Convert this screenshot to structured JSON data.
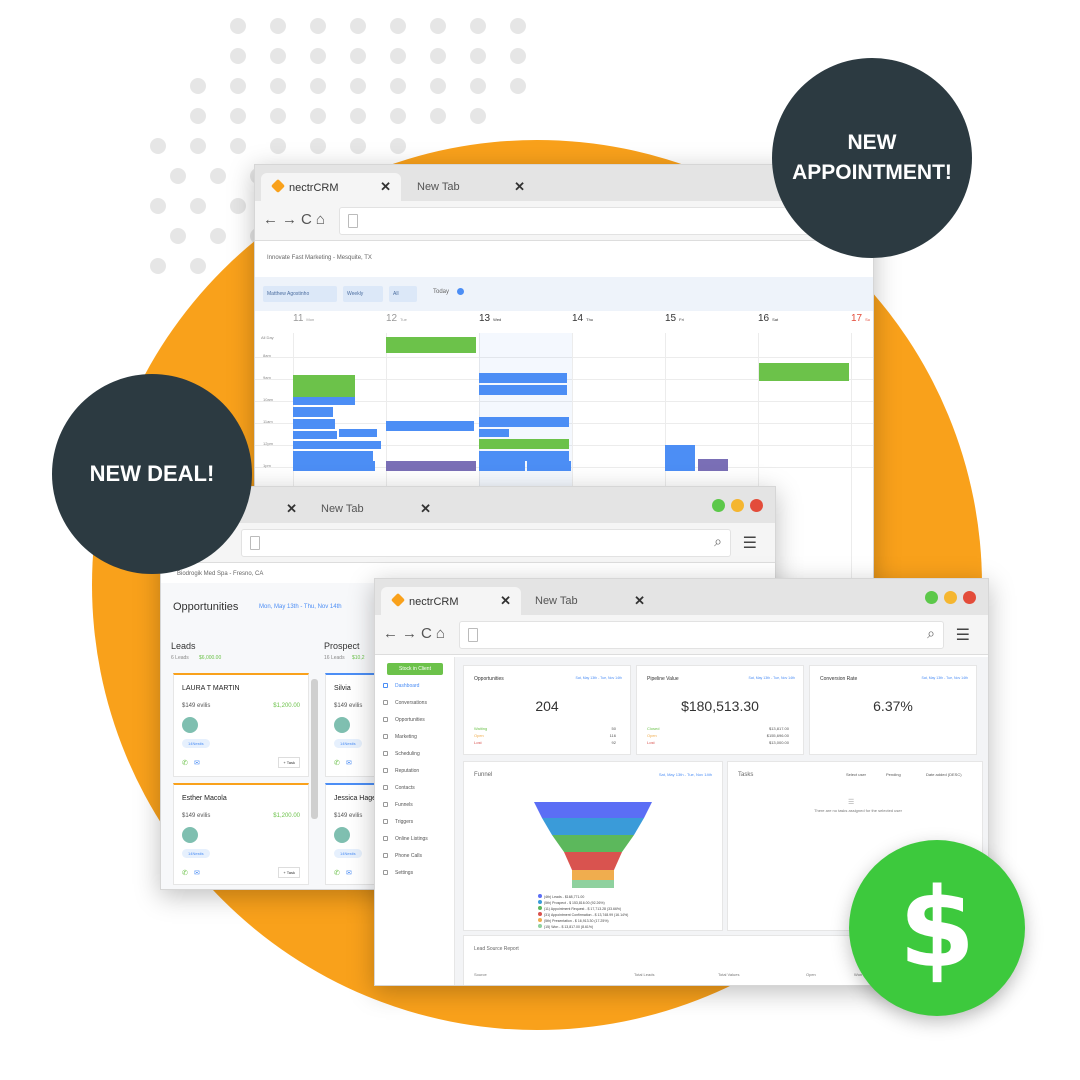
{
  "badges": {
    "appointment_line1": "NEW",
    "appointment_line2": "APPOINTMENT!",
    "deal": "NEW DEAL!"
  },
  "dollar_symbol": "$",
  "calendar_window": {
    "tab_active": "nectrCRM",
    "tab_new": "New Tab",
    "location": "Innovate Fast Marketing - Mesquite, TX",
    "filters": [
      "Matthew Agostinho",
      "Weekly",
      "All"
    ],
    "today": "Today",
    "days": [
      {
        "num": "11",
        "name": "Mon"
      },
      {
        "num": "12",
        "name": "Tue"
      },
      {
        "num": "13",
        "name": "Wed"
      },
      {
        "num": "14",
        "name": "Thu"
      },
      {
        "num": "15",
        "name": "Fri"
      },
      {
        "num": "16",
        "name": "Sat"
      },
      {
        "num": "17",
        "name": "Su"
      }
    ],
    "allday": "All Day",
    "hours": [
      "8am",
      "9am",
      "10am",
      "11am",
      "12pm",
      "1pm"
    ]
  },
  "opportunities_window": {
    "tab_new": "New Tab",
    "location": "Biodrogik Med Spa - Fresno, CA",
    "title": "Opportunities",
    "range": "Mon, May 13th - Thu, Nov 14th",
    "columns": [
      {
        "name": "Leads",
        "sub": "6 Leads",
        "amount": "$6,000.00"
      },
      {
        "name": "Prospect",
        "sub": "16 Leads",
        "amount": "$10,2"
      }
    ],
    "cards": [
      {
        "name": "LAURA T MARTIN",
        "price": "$149 evilis",
        "amount": "$1,200.00",
        "tag": "14Nestis",
        "task": "+ Task"
      },
      {
        "name": "Silvia",
        "price": "$149 evilis",
        "tag": "14Nestis"
      },
      {
        "name": "Esther Macola",
        "price": "$149 evilis",
        "amount": "$1,200.00",
        "tag": "14Nestis",
        "task": "+ Task"
      },
      {
        "name": "Jessica Hage",
        "price": "$149 evilis",
        "tag": "14Nestis"
      }
    ]
  },
  "dashboard_window": {
    "tab_active": "nectrCRM",
    "tab_new": "New Tab",
    "button": "Stock in Client",
    "menu": [
      "Dashboard",
      "Conversations",
      "Opportunities",
      "Marketing",
      "Scheduling",
      "Reputation",
      "Contacts",
      "Funnels",
      "Triggers",
      "Online Listings",
      "Phone Calls",
      "Settings"
    ],
    "stats": [
      {
        "title": "Opportunities",
        "range": "Sat, May 13th - Tue, Nov 14th",
        "value": "204",
        "rows": [
          [
            "Waiting",
            "50"
          ],
          [
            "Open",
            "116"
          ],
          [
            "Lost",
            "92"
          ]
        ]
      },
      {
        "title": "Pipeline Value",
        "range": "Sat, May 13th - Tue, Nov 14th",
        "value": "$180,513.30",
        "rows": [
          [
            "Closed",
            "$13,817.00"
          ],
          [
            "Open",
            "$155,696.00"
          ],
          [
            "Lost",
            "$13,000.00"
          ]
        ]
      },
      {
        "title": "Conversion Rate",
        "range": "Sat, May 13th - Tue, Nov 14th",
        "value": "6.37%",
        "rows": []
      }
    ],
    "funnel": {
      "title": "Funnel",
      "range": "Sat, May 13th - Tue, Nov 14th",
      "legend": [
        "(4th) Leads - $168,771.00",
        "(5th) Prospect - $ 153,816.00 (92.26%)",
        "(11) Appointment Request - $ 17,713.28 (33.66%)",
        "(31) Appointment Confirmation - $ 13,748.99 (16.14%)",
        "(5th) Presentation - $ 16,913.30 (17.25%)",
        "(15) Won - $ 13,817.00 (8.61%)"
      ],
      "colors": [
        "#5b6ef5",
        "#3a9bd9",
        "#5cb85c",
        "#d9534f",
        "#f0ad4e",
        "#8fd19e"
      ]
    },
    "tasks": {
      "title": "Tasks",
      "filters": [
        "Select user",
        "Pending",
        "Date added (DESC)"
      ],
      "empty": "There are no tasks assigned for the selected user"
    },
    "report": {
      "title": "Lead Source Report",
      "cols": [
        "Source",
        "Total Leads",
        "Total Values",
        "Open",
        "Won"
      ]
    }
  },
  "colors": {
    "orange": "#f9a11b",
    "dark": "#2c3a41",
    "green": "#3dc93d"
  }
}
